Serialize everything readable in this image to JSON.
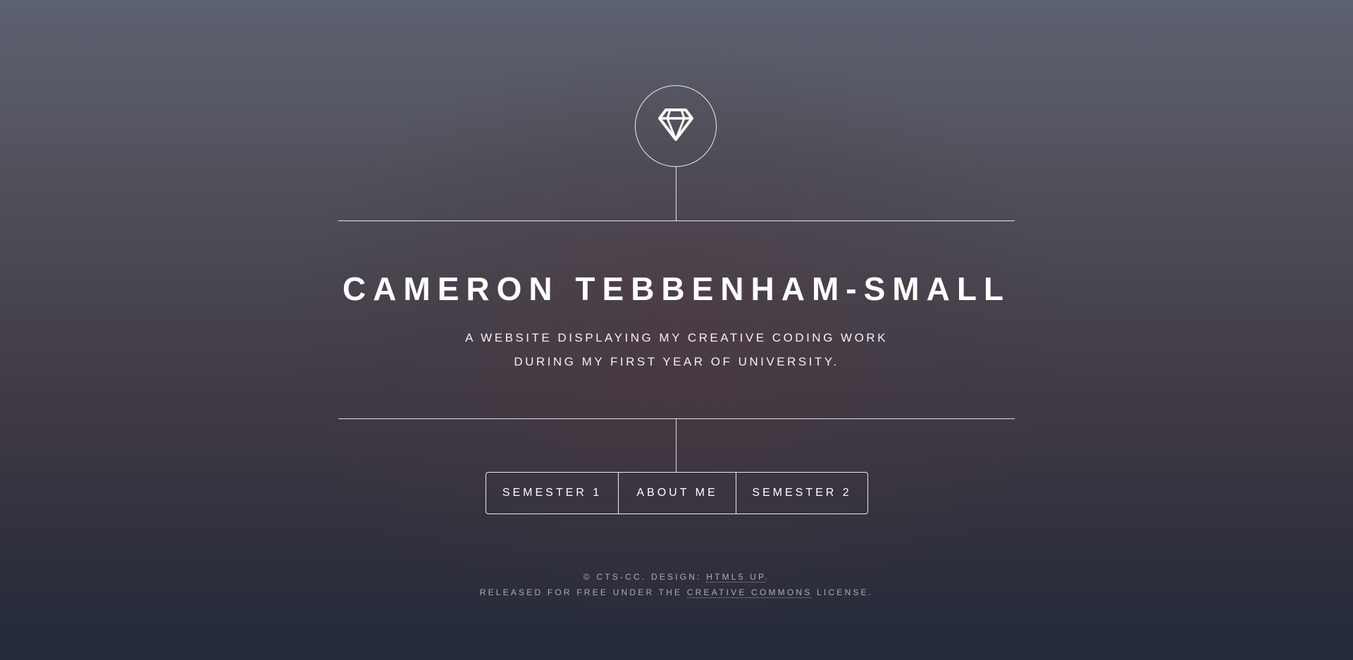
{
  "header": {
    "logo_icon": "diamond-icon",
    "title": "CAMERON TEBBENHAM-SMALL",
    "subtitle_line1": "A WEBSITE DISPLAYING MY CREATIVE CODING WORK",
    "subtitle_line2": "DURING MY FIRST YEAR OF UNIVERSITY."
  },
  "nav": {
    "items": [
      {
        "label": "SEMESTER 1"
      },
      {
        "label": "ABOUT ME"
      },
      {
        "label": "SEMESTER 2"
      }
    ]
  },
  "footer": {
    "line1_prefix": "© CTS-CC. DESIGN: ",
    "line1_link": "HTML5 UP",
    "line1_suffix": ".",
    "line2_prefix": "RELEASED FOR FREE UNDER THE ",
    "line2_link": "CREATIVE COMMONS",
    "line2_suffix": " LICENSE."
  }
}
